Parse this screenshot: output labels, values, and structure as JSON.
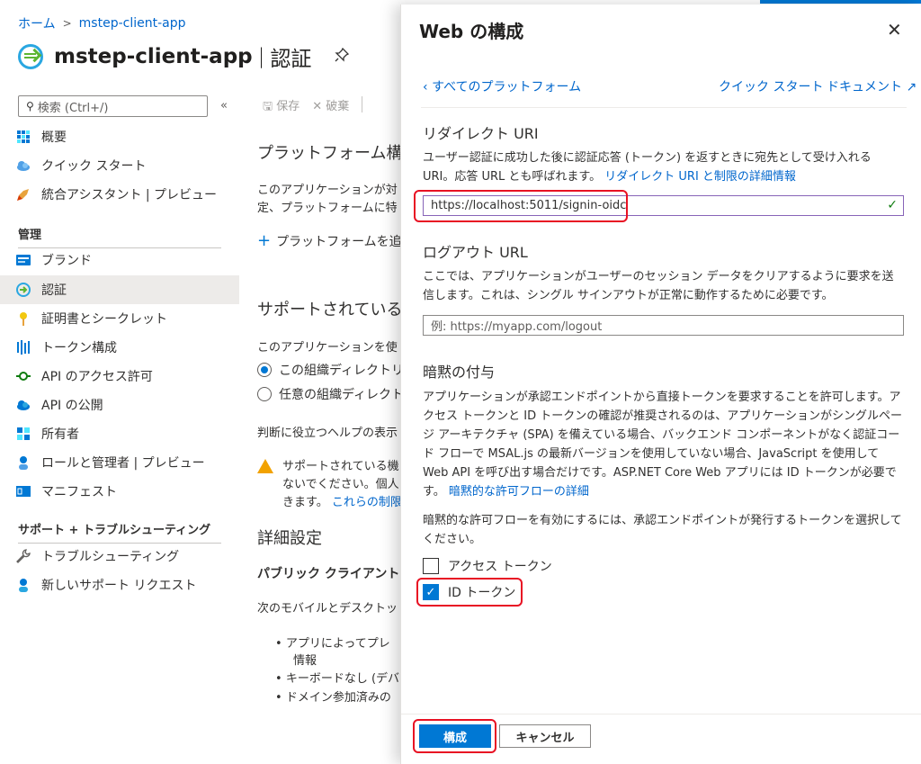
{
  "breadcrumb": {
    "home": "ホーム",
    "sep": ">",
    "app": "mstep-client-app"
  },
  "header": {
    "app_name": "mstep-client-app",
    "separator": "|",
    "page": "認証",
    "pin_icon": "pin-icon"
  },
  "sidebar": {
    "search_placeholder": "検索 (Ctrl+/)",
    "collapse": "«",
    "items_top": [
      {
        "label": "概要",
        "icon": "grid-icon"
      },
      {
        "label": "クイック スタート",
        "icon": "cloud-icon"
      },
      {
        "label": "統合アシスタント | プレビュー",
        "icon": "rocket-icon"
      }
    ],
    "section_manage": "管理",
    "items_manage": [
      {
        "label": "ブランド",
        "icon": "brand-icon"
      },
      {
        "label": "認証",
        "icon": "auth-icon",
        "active": true
      },
      {
        "label": "証明書とシークレット",
        "icon": "key-icon"
      },
      {
        "label": "トークン構成",
        "icon": "bars-icon"
      },
      {
        "label": "API のアクセス許可",
        "icon": "api-permission-icon"
      },
      {
        "label": "API の公開",
        "icon": "cloud-api-icon"
      },
      {
        "label": "所有者",
        "icon": "owners-icon"
      },
      {
        "label": "ロールと管理者 | プレビュー",
        "icon": "roles-icon"
      },
      {
        "label": "マニフェスト",
        "icon": "manifest-icon"
      }
    ],
    "section_support": "サポート + トラブルシューティング",
    "items_support": [
      {
        "label": "トラブルシューティング",
        "icon": "wrench-icon"
      },
      {
        "label": "新しいサポート リクエスト",
        "icon": "support-person-icon"
      }
    ]
  },
  "middle": {
    "toolbar": {
      "save": "保存",
      "discard": "破棄"
    },
    "platform_heading": "プラットフォーム構",
    "platform_desc_1": "このアプリケーションが対",
    "platform_desc_2": "定、プラットフォームに特",
    "add_platform": "プラットフォームを追",
    "supported_heading": "サポートされている",
    "supported_desc": "このアプリケーションを使",
    "radio_1": "この組織ディレクトリ",
    "radio_2": "任意の組織ディレクト",
    "help_link": "判断に役立つヘルプの表示",
    "warning_1": "サポートされている機",
    "warning_2": "ないでください。個人",
    "warning_3": "きます。",
    "warning_link": "これらの制限",
    "advanced_heading": "詳細設定",
    "public_client_heading": "パブリック クライアント",
    "mobile_desc": "次のモバイルとデスクトッ",
    "bullet_1": "アプリによってプレ",
    "bullet_1b": "情報",
    "bullet_2": "キーボードなし (デバ",
    "bullet_3": "ドメイン参加済みの"
  },
  "panel": {
    "title": "Web の構成",
    "close": "✕",
    "back_link": "すべてのプラットフォーム",
    "quickstart_link": "クイック スタート",
    "docs_link": "ドキュメント",
    "redirect": {
      "heading": "リダイレクト URI",
      "desc": "ユーザー認証に成功した後に認証応答 (トークン) を返すときに宛先として受け入れる URI。応答 URL とも呼ばれます。",
      "desc_link": "リダイレクト URI と制限の詳細情報",
      "value": "https://localhost:5011/signin-oidc"
    },
    "logout": {
      "heading": "ログアウト URL",
      "desc": "ここでは、アプリケーションがユーザーのセッション データをクリアするように要求を送信します。これは、シングル サインアウトが正常に動作するために必要です。",
      "placeholder": "例: https://myapp.com/logout"
    },
    "implicit": {
      "heading": "暗黙の付与",
      "desc": "アプリケーションが承認エンドポイントから直接トークンを要求することを許可します。アクセス トークンと ID トークンの確認が推奨されるのは、アプリケーションがシングルページ アーキテクチャ (SPA) を備えている場合、バックエンド コンポーネントがなく認証コード フローで MSAL.js の最新バージョンを使用していない場合、JavaScript を使用して Web API を呼び出す場合だけです。ASP.NET Core Web アプリには ID トークンが必要です。",
      "desc_link": "暗黙的な許可フローの詳細",
      "select_desc": "暗黙的な許可フローを有効にするには、承認エンドポイントが発行するトークンを選択してください。",
      "access_token": "アクセス トークン",
      "access_token_checked": false,
      "id_token": "ID トークン",
      "id_token_checked": true
    },
    "configure_button": "構成",
    "cancel_button": "キャンセル"
  }
}
